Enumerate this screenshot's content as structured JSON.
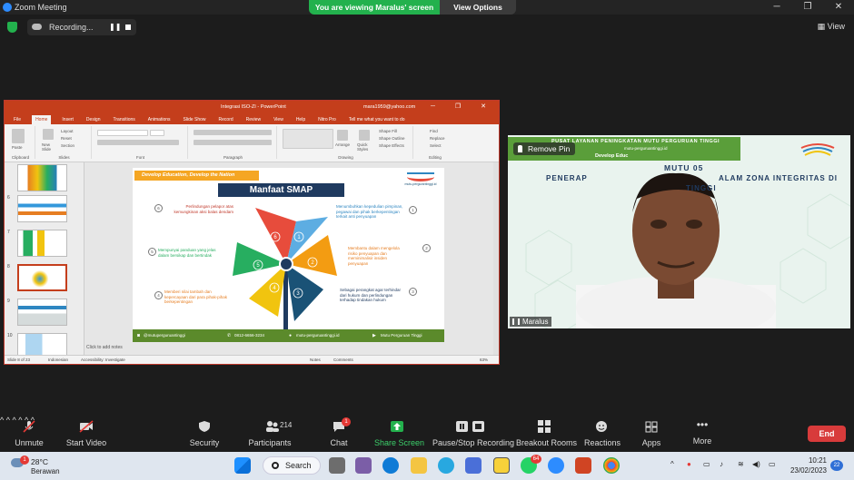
{
  "window": {
    "app_title": "Zoom Meeting",
    "viewing_message": "You are viewing Maralus' screen",
    "view_options_label": "View Options",
    "view_label": "View"
  },
  "recording": {
    "label": "Recording..."
  },
  "powerpoint": {
    "doc_title": "Integrasi ISO-ZI  -  PowerPoint",
    "user": "mara1959@yahoo.com",
    "tabs": [
      "File",
      "Home",
      "Insert",
      "Design",
      "Transitions",
      "Animations",
      "Slide Show",
      "Record",
      "Review",
      "View",
      "Help",
      "Nitro Pro",
      "Tell me what you want to do"
    ],
    "ribbon_groups": [
      "Clipboard",
      "Slides",
      "Font",
      "Paragraph",
      "Drawing",
      "Editing"
    ],
    "ribbon_items": {
      "paste": "Paste",
      "new_slide": "New Slide",
      "layout": "Layout",
      "reset": "Reset",
      "section": "Section",
      "arrange": "Arrange",
      "quick_styles": "Quick Styles",
      "shape_fill": "Shape Fill",
      "shape_outline": "Shape Outline",
      "shape_effects": "Shape Effects",
      "find": "Find",
      "replace": "Replace",
      "select": "Select"
    },
    "thumb_numbers": [
      "",
      "6",
      "7",
      "8",
      "9",
      "10"
    ],
    "click_to_add_notes": "Click to add notes",
    "status": {
      "slide": "Slide 8 of 23",
      "language": "Indonesian",
      "accessibility": "Accessibility: Investigate",
      "notes": "Notes",
      "comments": "Comments",
      "zoom": "63%"
    }
  },
  "slide": {
    "banner": "Develop Education, Develop the Nation",
    "logo_text": "mutu-pergurantinggi.id",
    "heading": "Manfaat SMAP",
    "items": [
      {
        "num": "1",
        "text": "Menumbuhkan kepedulian pimpinan, pegawai dan pihak berkepentingan terkait anti penyuapan"
      },
      {
        "num": "2",
        "text": "Membantu dalam mengelola risiko penyuapan dan meminimalisir insiden penyuapan"
      },
      {
        "num": "3",
        "text": "Sebagai perangkat agar terhindar dari hukum dan perlindungan terhadap tindakan hukum"
      },
      {
        "num": "4",
        "text": "Memberi nilai tambah dan kepercayaan dari para pihak-pihak berkepentingan"
      },
      {
        "num": "5",
        "text": "Mempunyai panduan yang jelas dalam bersikap dan bertindak"
      },
      {
        "num": "6",
        "text": "Perlindungan pelapor atas kemungkinan aksi balas dendam"
      }
    ],
    "pinwheel_numbers": [
      "1",
      "2",
      "3",
      "4",
      "5",
      "6"
    ],
    "footer": {
      "instagram": "@mutuperguruantinggi",
      "phone": "0812-6656-3234",
      "web": "mutu-perguruantinggi.id",
      "youtube": "Mutu Perguruan Tinggi"
    }
  },
  "speaker": {
    "banner_line1": "PUSAT LAYANAN PENINGKATAN MUTU PERGURUAN TINGGI",
    "banner_line2": "mutu-perguruantinggi.id",
    "banner_line3": "Develop Educ",
    "remove_pin": "Remove Pin",
    "line_a": "MUTU 05",
    "line_b": "PENERAP",
    "line_b2": "ALAM ZONA INTEGRITAS DI",
    "line_c": "TINGGI",
    "name": "Maralus"
  },
  "toolbar": {
    "unmute": "Unmute",
    "start_video": "Start Video",
    "security": "Security",
    "participants": "Participants",
    "participants_count": "214",
    "chat": "Chat",
    "chat_badge": "1",
    "share_screen": "Share Screen",
    "pause_stop": "Pause/Stop Recording",
    "breakout": "Breakout Rooms",
    "reactions": "Reactions",
    "apps": "Apps",
    "more": "More",
    "end": "End"
  },
  "taskbar": {
    "temp": "28°C",
    "weather": "Berawan",
    "weather_badge": "1",
    "search": "Search",
    "whatsapp_badge": "64",
    "time": "10:21",
    "date": "23/02/2023",
    "notif_count": "22"
  },
  "colors": {
    "zoom_green": "#23b14d",
    "ppt_red": "#c43e1c",
    "end_red": "#d83b3b",
    "slide_navy": "#1f3a5f",
    "slide_green": "#5b8a2b",
    "slide_orange": "#f5a623"
  }
}
